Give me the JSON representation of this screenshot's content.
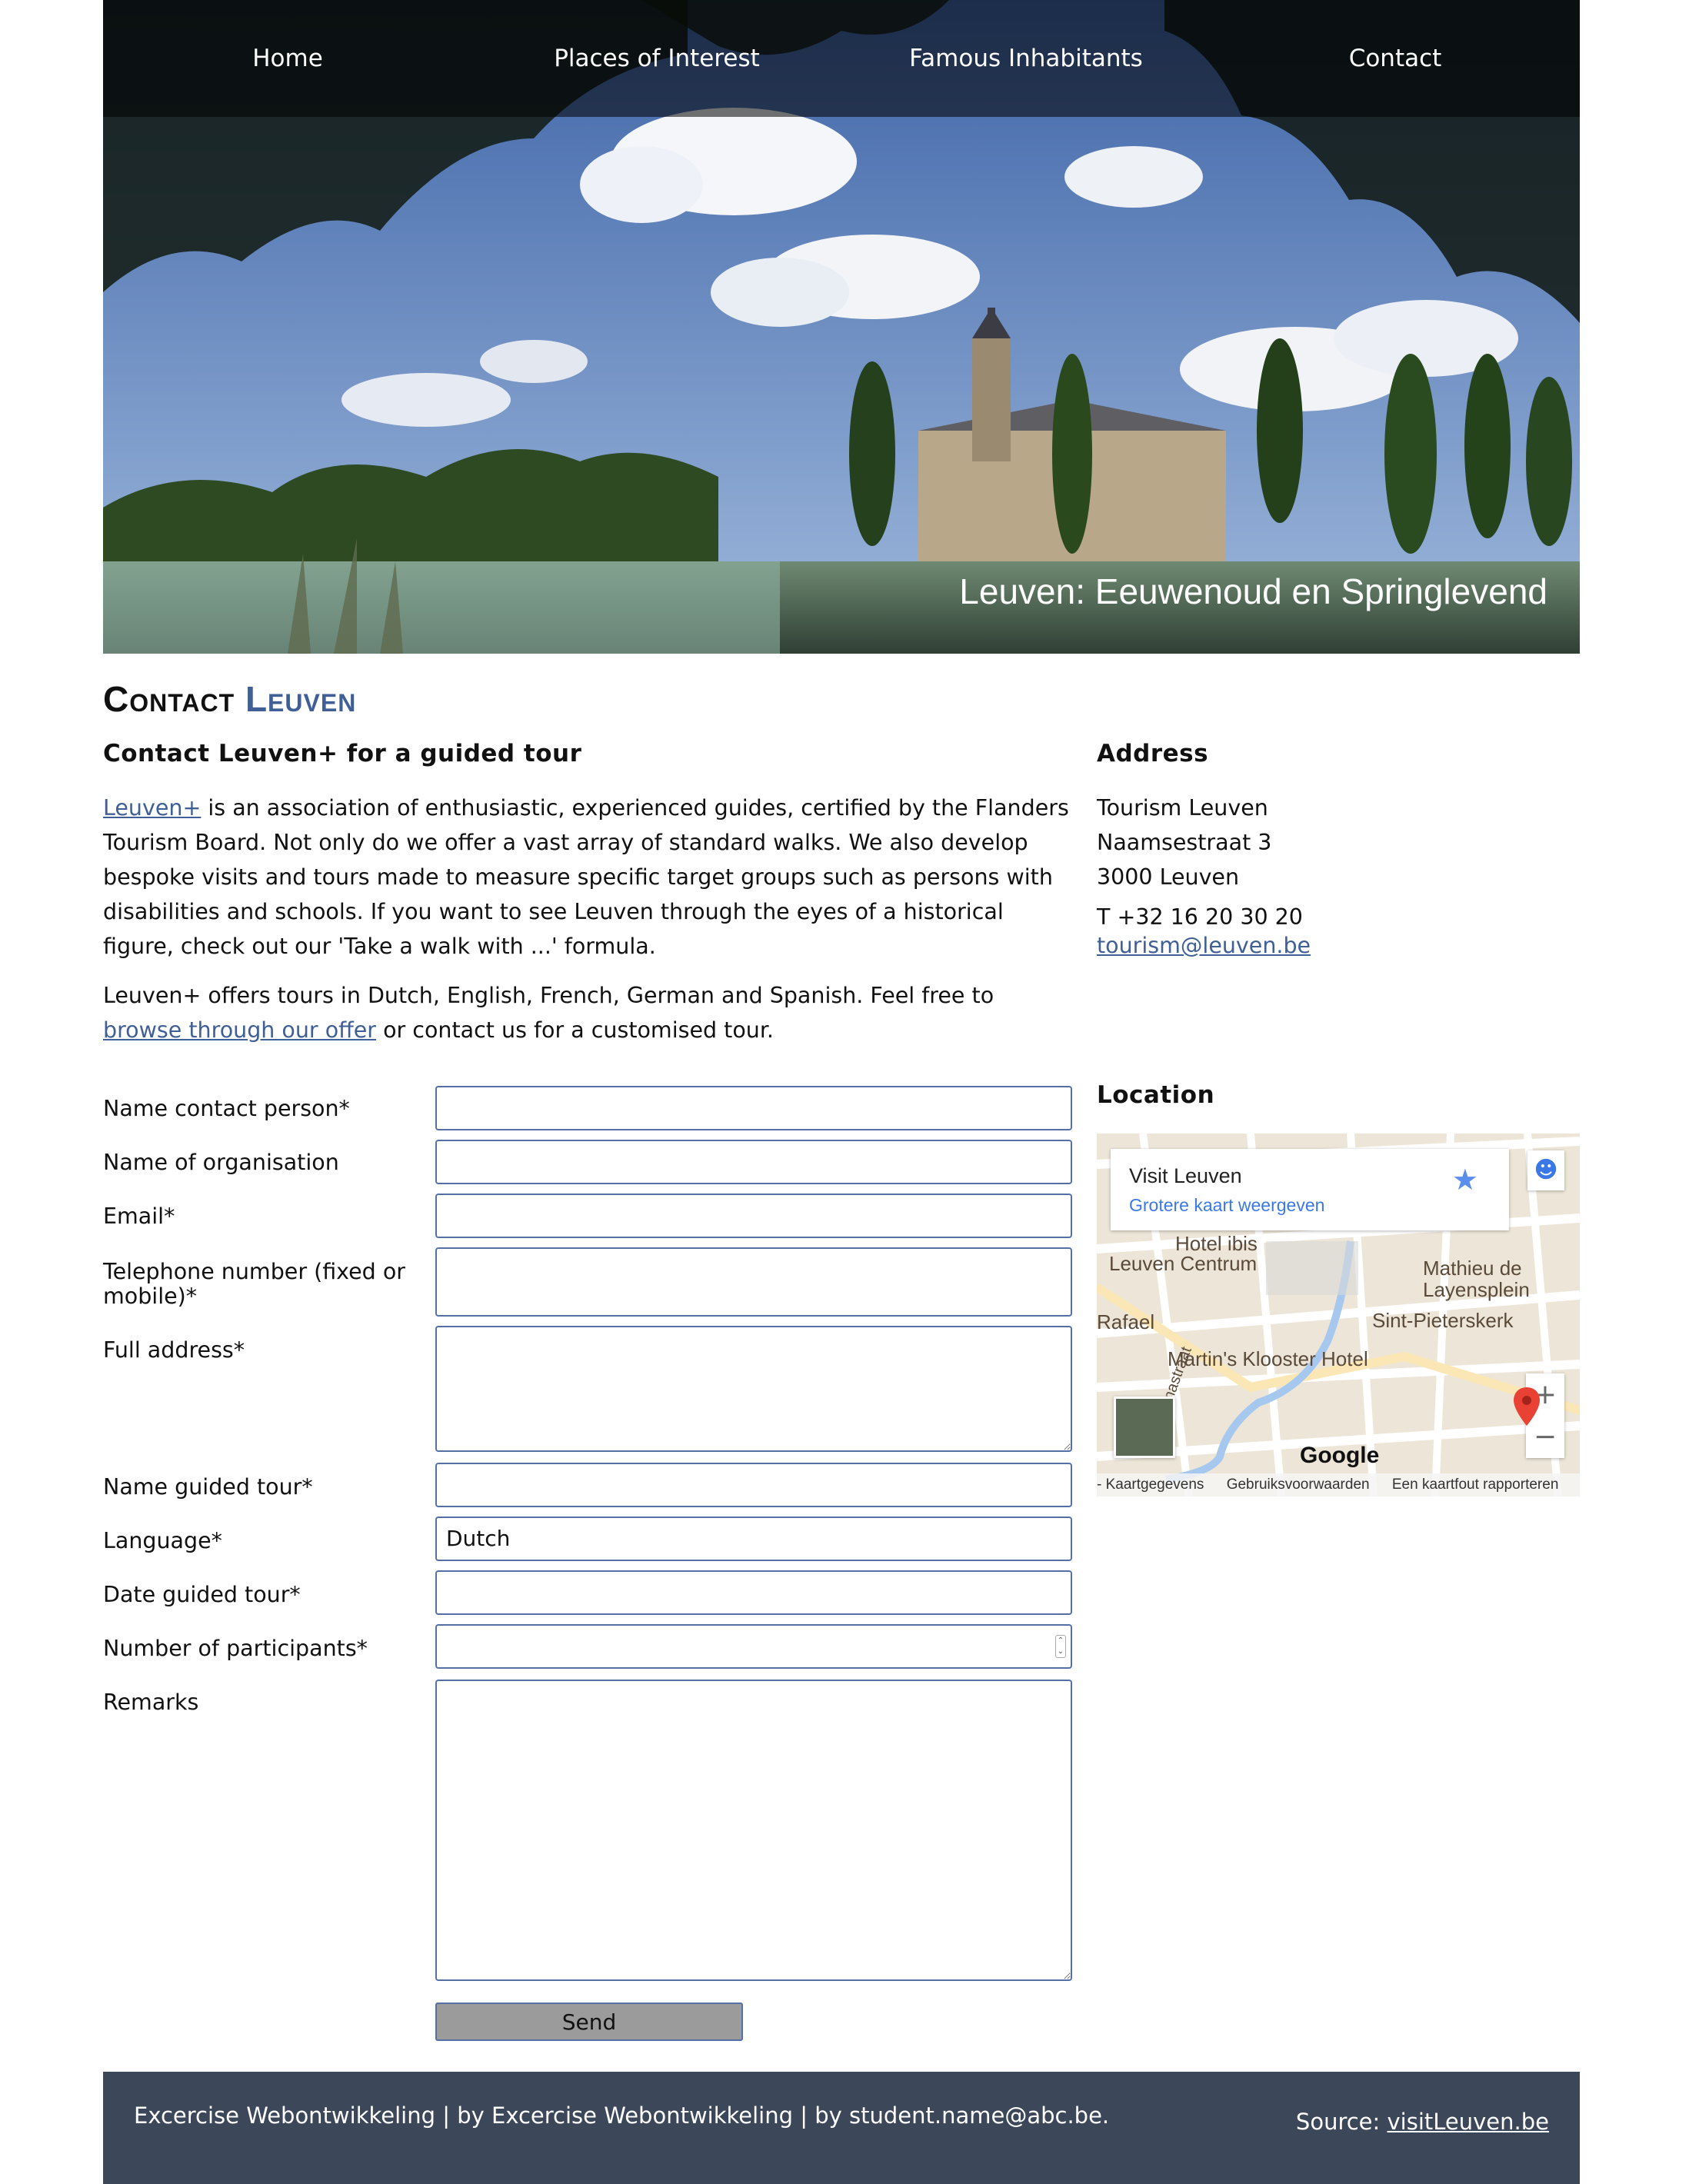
{
  "nav": {
    "items": [
      "Home",
      "Places of Interest",
      "Famous Inhabitants",
      "Contact"
    ]
  },
  "hero": {
    "tagline": "Leuven: Eeuwenoud en Springlevend"
  },
  "title": {
    "part1": "Contact",
    "part2": "Leuven"
  },
  "intro": {
    "heading": "Contact Leuven+ for a guided tour",
    "link1": "Leuven+",
    "p1_rest": " is an association of enthusiastic, experienced guides, certified by the Flanders Tourism Board. Not only do we offer a vast array of standard walks. We also develop bespoke visits and tours made to measure specific target groups such as persons with disabilities and schools. If you want to see Leuven through the eyes of a historical figure, check out our 'Take a walk with ...' formula.",
    "p2_start": "Leuven+ offers tours in Dutch, English, French, German and Spanish. Feel free to ",
    "p2_link": "browse through our offer",
    "p2_end": " or contact us for a customised tour."
  },
  "address": {
    "heading": "Address",
    "line1": "Tourism Leuven",
    "line2": "Naamsestraat 3",
    "line3": "3000 Leuven",
    "phone": "T +32 16 20 30 20",
    "email": "tourism@leuven.be"
  },
  "location": {
    "heading": "Location",
    "map": {
      "info_title": "Visit Leuven",
      "info_link": "Grotere kaart weergeven",
      "labels": [
        "Hotel ibis",
        "Leuven Centrum",
        "Mathieu de",
        "Layensplein",
        "Rafael",
        "Sint-Pieterskerk",
        "Martin's Klooster Hotel",
        "Sint-Annastraat"
      ],
      "google": "Google",
      "attribution": [
        "- Kaartgegevens",
        "Gebruiksvoorwaarden",
        "Een kaartfout rapporteren"
      ]
    }
  },
  "form": {
    "labels": {
      "name": "Name contact person*",
      "org": "Name of organisation",
      "email": "Email*",
      "phone": "Telephone number (fixed or mobile)*",
      "address": "Full address*",
      "tour": "Name guided tour*",
      "language": "Language*",
      "date": "Date guided tour*",
      "participants": "Number of participants*",
      "remarks": "Remarks"
    },
    "language_value": "Dutch",
    "send_label": "Send"
  },
  "footer": {
    "left": "Excercise Webontwikkeling | by Excercise Webontwikkeling | by student.name@abc.be.",
    "source_prefix": "Source: ",
    "source_link": "visitLeuven.be"
  }
}
